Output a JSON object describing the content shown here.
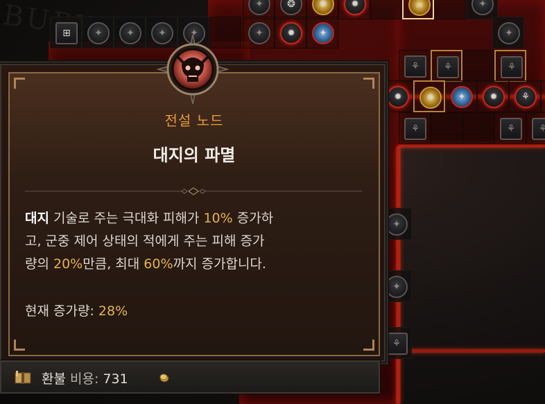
{
  "tooltip": {
    "rarity": "전설 노드",
    "title": "대지의 파멸",
    "description": {
      "keyword": "대지",
      "line1_rest": " 기술로 주는 극대화 피해가 ",
      "value1": "10%",
      "line1_end": " 증가하",
      "line2": "고, 군중 제어 상태의 적에게 주는 피해 증가",
      "line3_start": "량의 ",
      "value2": "20%",
      "line3_mid": "만큼, 최대 ",
      "value3": "60%",
      "line3_end": "까지 증가합니다."
    },
    "current": {
      "label": "현재 증가량: ",
      "value": "28%"
    },
    "refund": {
      "label": "환불",
      "cost_label": " 비용: ",
      "cost_value": "731"
    },
    "emblem_icon": "demon-skull-icon",
    "refund_icon": "book-icon",
    "coin_icon": "gold-coin-icon"
  },
  "colors": {
    "rarity": "#e59a3a",
    "highlight": "#e6b24e",
    "board_red": "#c0180e",
    "frame_gold": "#b08456"
  },
  "board": {
    "watermark": "BURY"
  }
}
